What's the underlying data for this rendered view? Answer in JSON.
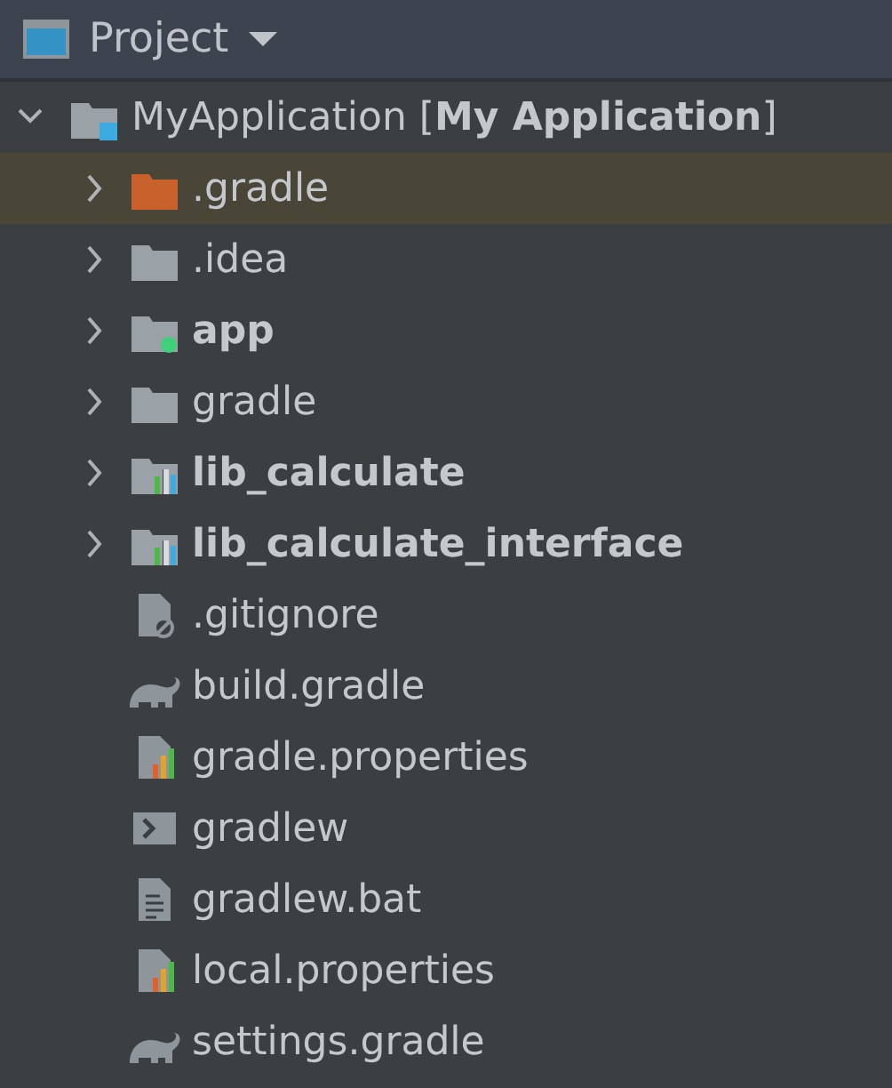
{
  "panel": {
    "title": "Project"
  },
  "tree": [
    {
      "label": "MyApplication [**My Application**]",
      "kind": "project",
      "expanded": true,
      "selected": false,
      "children": [
        {
          "label": ".gradle",
          "kind": "excluded-folder",
          "expanded": false,
          "selected": true
        },
        {
          "label": ".idea",
          "kind": "folder",
          "expanded": false,
          "selected": false
        },
        {
          "label": "app",
          "kind": "app-module",
          "expanded": false,
          "selected": false
        },
        {
          "label": "gradle",
          "kind": "folder",
          "expanded": false,
          "selected": false
        },
        {
          "label": "lib_calculate",
          "kind": "lib-module",
          "expanded": false,
          "selected": false
        },
        {
          "label": "lib_calculate_interface",
          "kind": "lib-module",
          "expanded": false,
          "selected": false
        },
        {
          "label": ".gitignore",
          "kind": "ignore-file",
          "selected": false
        },
        {
          "label": "build.gradle",
          "kind": "gradle-file",
          "selected": false
        },
        {
          "label": "gradle.properties",
          "kind": "properties-file",
          "selected": false
        },
        {
          "label": "gradlew",
          "kind": "shell-file",
          "selected": false
        },
        {
          "label": "gradlew.bat",
          "kind": "text-file",
          "selected": false
        },
        {
          "label": "local.properties",
          "kind": "properties-file",
          "selected": false
        },
        {
          "label": "settings.gradle",
          "kind": "gradle-file",
          "selected": false
        }
      ]
    }
  ]
}
